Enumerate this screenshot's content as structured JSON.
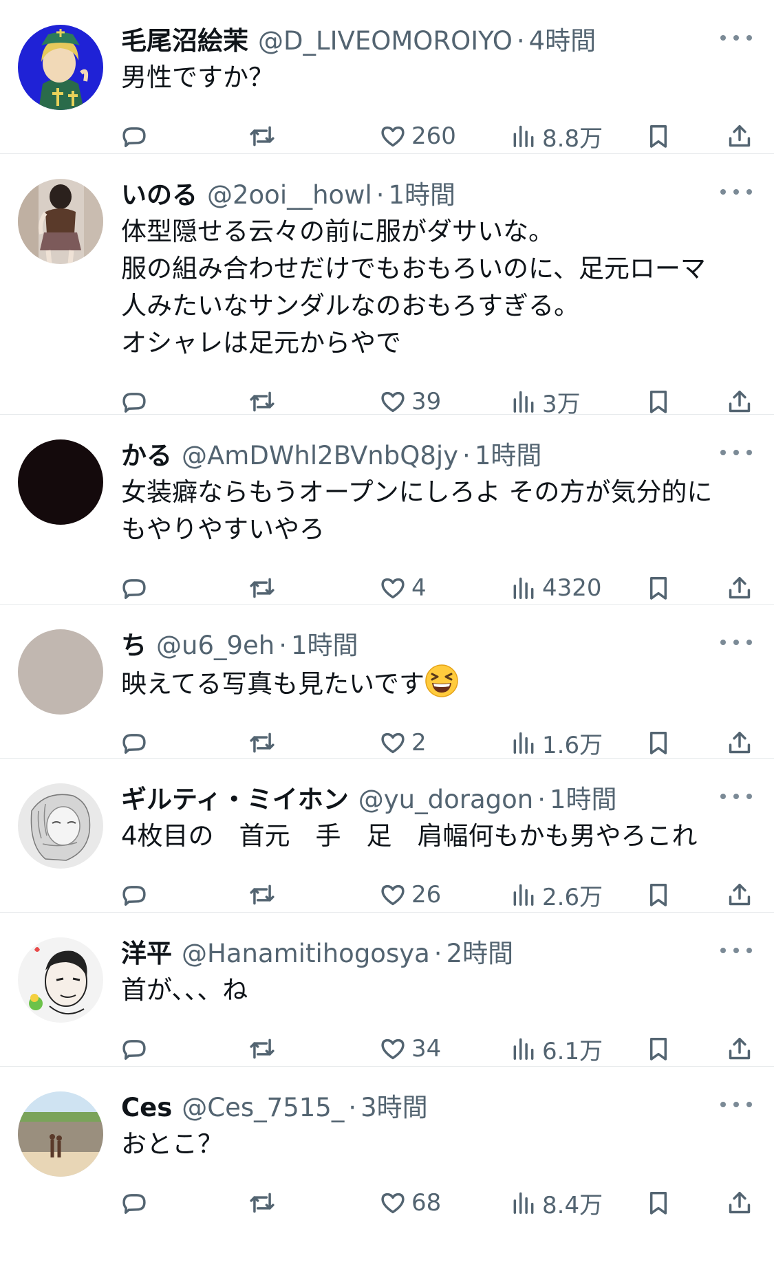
{
  "tweets": [
    {
      "name": "毛尾沼絵茉",
      "handle": "@D_LIVEOMOROIYO",
      "time": "4時間",
      "text": "男性ですか？",
      "likes": "260",
      "views": "8.8万",
      "avatar": "anime-character"
    },
    {
      "name": "いのる",
      "handle": "@2ooi__howl",
      "time": "1時間",
      "text": "体型隠せる云々の前に服がダサいな。\n服の組み合わせだけでもおもろいのに、足元ローマ\n人みたいなサンダルなのおもろすぎる。\nオシャレは足元からやで",
      "likes": "39",
      "views": "3万",
      "avatar": "photo-person"
    },
    {
      "name": "かる",
      "handle": "@AmDWhl2BVnbQ8jy",
      "time": "1時間",
      "text": "女装癖ならもうオープンにしろよ その方が気分的に\nもやりやすいやろ",
      "likes": "4",
      "views": "4320",
      "avatar": "solid-dark"
    },
    {
      "name": "ち",
      "handle": "@u6_9eh",
      "time": "1時間",
      "text": "映えてる写真も見たいです",
      "emoji": "grinning-squinting-face",
      "likes": "2",
      "views": "1.6万",
      "avatar": "solid-gray"
    },
    {
      "name": "ギルティ・ミイホン",
      "handle": "@yu_doragon",
      "time": "1時間",
      "text": "4枚目の　首元　手　足　肩幅何もかも男やろこれ",
      "likes": "26",
      "views": "2.6万",
      "avatar": "sketch-girl"
    },
    {
      "name": "洋平",
      "handle": "@Hanamitihogosya",
      "time": "2時間",
      "text": "首が、、、ね",
      "likes": "34",
      "views": "6.1万",
      "avatar": "cartoon-man-bird"
    },
    {
      "name": "Ces",
      "handle": "@Ces_7515_",
      "time": "3時間",
      "text": "おとこ？",
      "likes": "68",
      "views": "8.4万",
      "avatar": "photo-beach"
    }
  ],
  "icons": {
    "reply": "reply-icon",
    "retweet": "retweet-icon",
    "like": "heart-icon",
    "views": "views-icon",
    "bookmark": "bookmark-icon",
    "share": "share-icon",
    "more": "more-icon"
  },
  "colors": {
    "text": "#0f1419",
    "secondary": "#536471",
    "divider": "#e6e9eb"
  }
}
